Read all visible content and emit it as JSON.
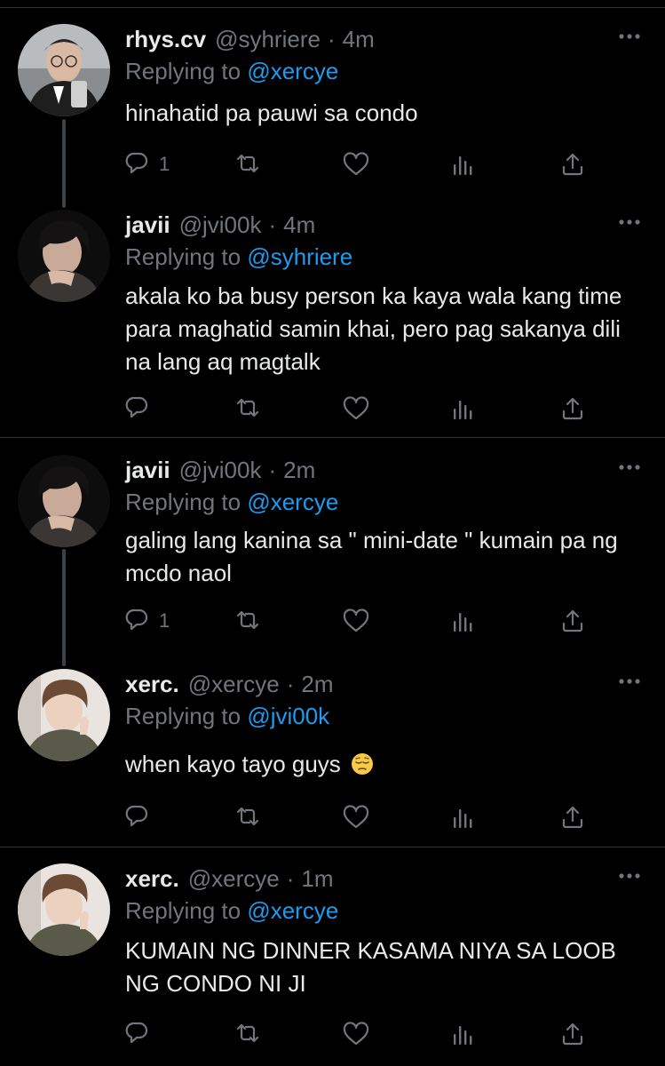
{
  "colors": {
    "background": "#000000",
    "text": "#e7e9ea",
    "secondary": "#71767b",
    "mention": "#1d9bf0",
    "divider": "#2f3336"
  },
  "replying_prefix": "Replying to",
  "tweets": [
    {
      "name": "rhys.cv",
      "handle": "@syhriere",
      "time": "4m",
      "replying_to": "@xercye",
      "text": "hinahatid pa pauwi sa condo",
      "reply_count": "1",
      "avatar_icon": "avatar-rhys"
    },
    {
      "name": "javii",
      "handle": "@jvi00k",
      "time": "4m",
      "replying_to": "@syhriere",
      "text": "akala ko ba busy person ka kaya wala kang time para maghatid samin khai, pero pag sakanya dili na lang aq magtalk",
      "reply_count": "",
      "avatar_icon": "avatar-javii"
    },
    {
      "name": "javii",
      "handle": "@jvi00k",
      "time": "2m",
      "replying_to": "@xercye",
      "text": "galing lang kanina sa \" mini-date \" kumain pa ng mcdo naol",
      "reply_count": "1",
      "avatar_icon": "avatar-javii"
    },
    {
      "name": "xerc.",
      "handle": "@xercye",
      "time": "2m",
      "replying_to": "@jvi00k",
      "text": "when kayo tayo guys",
      "emoji": "pensive-face-emoji",
      "reply_count": "",
      "avatar_icon": "avatar-xerc"
    },
    {
      "name": "xerc.",
      "handle": "@xercye",
      "time": "1m",
      "replying_to": "@xercye",
      "text": "KUMAIN NG DINNER KASAMA NIYA SA LOOB NG CONDO NI JI",
      "reply_count": "",
      "avatar_icon": "avatar-xerc"
    }
  ]
}
